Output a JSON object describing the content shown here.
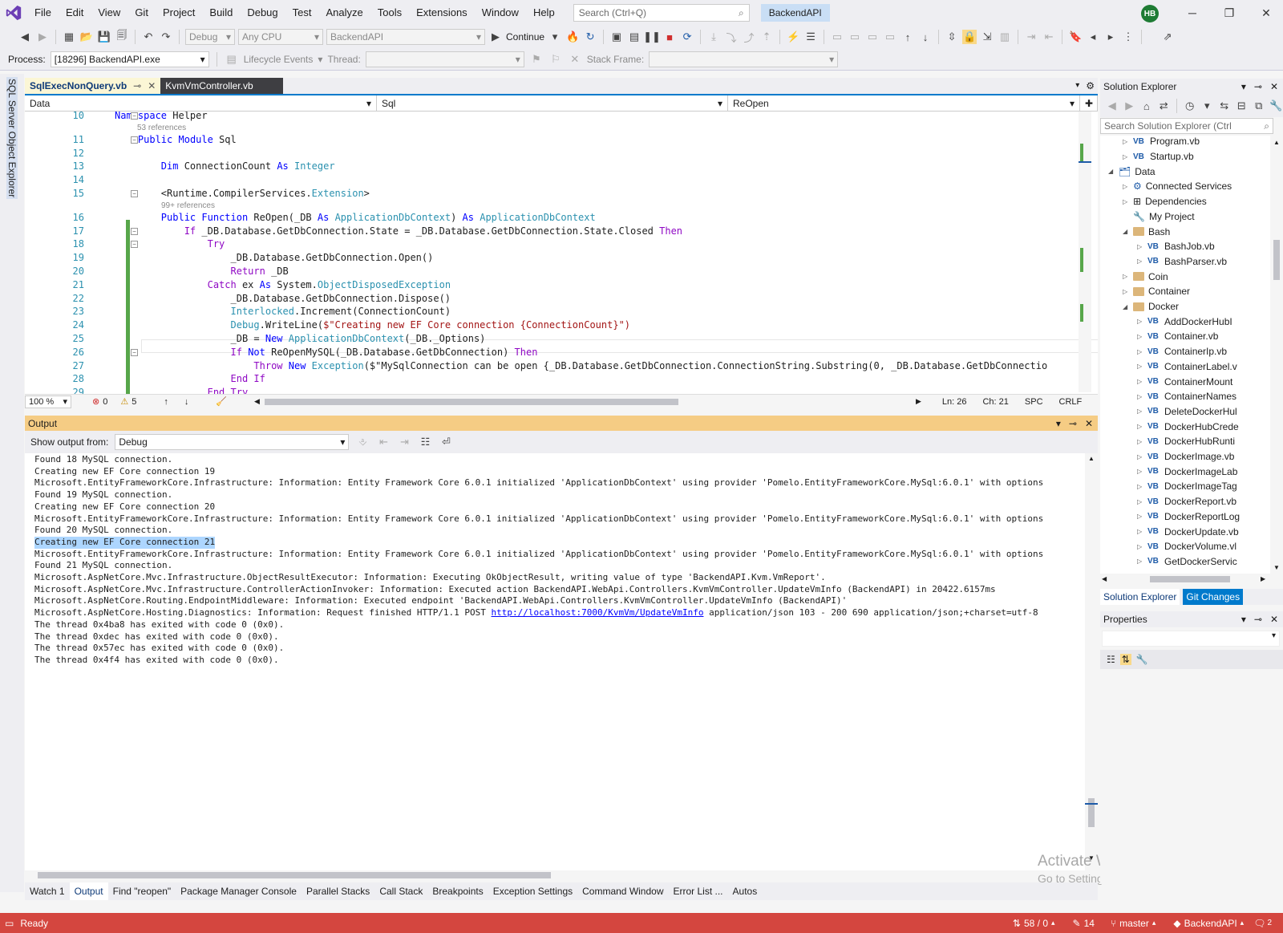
{
  "menu": [
    "File",
    "Edit",
    "View",
    "Git",
    "Project",
    "Build",
    "Debug",
    "Test",
    "Analyze",
    "Tools",
    "Extensions",
    "Window",
    "Help"
  ],
  "search": {
    "placeholder": "Search (Ctrl+Q)"
  },
  "solution_name": "BackendAPI",
  "user_initials": "HB",
  "toolbar": {
    "config": "Debug",
    "platform": "Any CPU",
    "startup": "BackendAPI",
    "continue_label": "Continue"
  },
  "debug_bar": {
    "process_label": "Process:",
    "process_value": "[18296] BackendAPI.exe",
    "lifecycle_label": "Lifecycle Events",
    "thread_label": "Thread:",
    "stackframe_label": "Stack Frame:"
  },
  "left_tab": "SQL Server Object Explorer",
  "doc_tabs": [
    {
      "label": "SqlExecNonQuery.vb",
      "active": true
    },
    {
      "label": "KvmVmController.vb",
      "active": false
    }
  ],
  "navbar": {
    "project": "Data",
    "scope": "Sql",
    "member": "ReOpen"
  },
  "code_lines": [
    {
      "num": "10",
      "text": "Namespace Helper"
    },
    {
      "refs": "53 references"
    },
    {
      "num": "11",
      "text": "    Public Module Sql"
    },
    {
      "num": "12",
      "text": ""
    },
    {
      "num": "13",
      "text": "        Dim ConnectionCount As Integer"
    },
    {
      "num": "14",
      "text": ""
    },
    {
      "num": "15",
      "text": "        <Runtime.CompilerServices.Extension>"
    },
    {
      "refs": "99+ references"
    },
    {
      "num": "16",
      "text": "        Public Function ReOpen(_DB As ApplicationDbContext) As ApplicationDbContext"
    },
    {
      "num": "17",
      "text": "            If _DB.Database.GetDbConnection.State = _DB.Database.GetDbConnection.State.Closed Then"
    },
    {
      "num": "18",
      "text": "                Try"
    },
    {
      "num": "19",
      "text": "                    _DB.Database.GetDbConnection.Open()"
    },
    {
      "num": "20",
      "text": "                    Return _DB"
    },
    {
      "num": "21",
      "text": "                Catch ex As System.ObjectDisposedException"
    },
    {
      "num": "22",
      "text": "                    _DB.Database.GetDbConnection.Dispose()"
    },
    {
      "num": "23",
      "text": "                    Interlocked.Increment(ConnectionCount)"
    },
    {
      "num": "24",
      "text": "                    Debug.WriteLine($\"Creating new EF Core connection {ConnectionCount}\")"
    },
    {
      "num": "25",
      "text": "                    _DB = New ApplicationDbContext(_DB._Options)"
    },
    {
      "num": "26",
      "text": "                    If Not ReOpenMySQL(_DB.Database.GetDbConnection) Then"
    },
    {
      "num": "27",
      "text": "                        Throw New Exception($\"MySqlConnection can be open {_DB.Database.GetDbConnection.ConnectionString.Substring(0, _DB.Database.GetDbConnectio"
    },
    {
      "num": "28",
      "text": "                    End If"
    },
    {
      "num": "29",
      "text": "                End Try"
    }
  ],
  "editor_status": {
    "zoom": "100 %",
    "errors": "0",
    "warnings": "5",
    "line": "Ln: 26",
    "col": "Ch: 21",
    "spacing": "SPC",
    "eol": "CRLF"
  },
  "output": {
    "title": "Output",
    "show_from_label": "Show output from:",
    "show_from_value": "Debug",
    "lines": [
      "Found 18 MySQL connection.",
      "Creating new EF Core connection 19",
      "Microsoft.EntityFrameworkCore.Infrastructure: Information: Entity Framework Core 6.0.1 initialized 'ApplicationDbContext' using provider 'Pomelo.EntityFrameworkCore.MySql:6.0.1' with options",
      "Found 19 MySQL connection.",
      "Creating new EF Core connection 20",
      "Microsoft.EntityFrameworkCore.Infrastructure: Information: Entity Framework Core 6.0.1 initialized 'ApplicationDbContext' using provider 'Pomelo.EntityFrameworkCore.MySql:6.0.1' with options",
      "Found 20 MySQL connection.",
      "Creating new EF Core connection 21",
      "Microsoft.EntityFrameworkCore.Infrastructure: Information: Entity Framework Core 6.0.1 initialized 'ApplicationDbContext' using provider 'Pomelo.EntityFrameworkCore.MySql:6.0.1' with options",
      "Found 21 MySQL connection.",
      "Microsoft.AspNetCore.Mvc.Infrastructure.ObjectResultExecutor: Information: Executing OkObjectResult, writing value of type 'BackendAPI.Kvm.VmReport'.",
      "Microsoft.AspNetCore.Mvc.Infrastructure.ControllerActionInvoker: Information: Executed action BackendAPI.WebApi.Controllers.KvmVmController.UpdateVmInfo (BackendAPI) in 20422.6157ms",
      "Microsoft.AspNetCore.Routing.EndpointMiddleware: Information: Executed endpoint 'BackendAPI.WebApi.Controllers.KvmVmController.UpdateVmInfo (BackendAPI)'",
      "Microsoft.AspNetCore.Hosting.Diagnostics: Information: Request finished HTTP/1.1 POST ",
      "The thread 0x4ba8 has exited with code 0 (0x0).",
      "The thread 0xdec has exited with code 0 (0x0).",
      "The thread 0x57ec has exited with code 0 (0x0).",
      "The thread 0x4f4 has exited with code 0 (0x0)."
    ],
    "selected_index": 7,
    "link_line_index": 13,
    "link_text": "http://localhost:7000/KvmVm/UpdateVmInfo",
    "link_suffix": " application/json 103 - 200 690 application/json;+charset=utf-8"
  },
  "bottom_tabs": [
    "Watch 1",
    "Output",
    "Find \"reopen\"",
    "Package Manager Console",
    "Parallel Stacks",
    "Call Stack",
    "Breakpoints",
    "Exception Settings",
    "Command Window",
    "Error List ...",
    "Autos"
  ],
  "solution_explorer": {
    "title": "Solution Explorer",
    "search_placeholder": "Search Solution Explorer (Ctrl",
    "items": [
      {
        "label": "Program.vb",
        "kind": "vb",
        "level": 1,
        "expander": "closed"
      },
      {
        "label": "Startup.vb",
        "kind": "vb",
        "level": 1,
        "expander": "closed"
      },
      {
        "label": "Data",
        "kind": "project",
        "level": 0,
        "expander": "open"
      },
      {
        "label": "Connected Services",
        "kind": "service",
        "level": 1,
        "expander": "closed"
      },
      {
        "label": "Dependencies",
        "kind": "deps",
        "level": 1,
        "expander": "closed"
      },
      {
        "label": "My Project",
        "kind": "myproj",
        "level": 1,
        "expander": "none"
      },
      {
        "label": "Bash",
        "kind": "folder",
        "level": 1,
        "expander": "open"
      },
      {
        "label": "BashJob.vb",
        "kind": "vb",
        "level": 2,
        "expander": "closed"
      },
      {
        "label": "BashParser.vb",
        "kind": "vb",
        "level": 2,
        "expander": "closed"
      },
      {
        "label": "Coin",
        "kind": "folder",
        "level": 1,
        "expander": "closed"
      },
      {
        "label": "Container",
        "kind": "folder",
        "level": 1,
        "expander": "closed"
      },
      {
        "label": "Docker",
        "kind": "folder",
        "level": 1,
        "expander": "open"
      },
      {
        "label": "AddDockerHubI",
        "kind": "vb",
        "level": 2,
        "expander": "closed"
      },
      {
        "label": "Container.vb",
        "kind": "vb",
        "level": 2,
        "expander": "closed"
      },
      {
        "label": "ContainerIp.vb",
        "kind": "vb",
        "level": 2,
        "expander": "closed"
      },
      {
        "label": "ContainerLabel.v",
        "kind": "vb",
        "level": 2,
        "expander": "closed"
      },
      {
        "label": "ContainerMount",
        "kind": "vb",
        "level": 2,
        "expander": "closed"
      },
      {
        "label": "ContainerNames",
        "kind": "vb",
        "level": 2,
        "expander": "closed"
      },
      {
        "label": "DeleteDockerHul",
        "kind": "vb",
        "level": 2,
        "expander": "closed"
      },
      {
        "label": "DockerHubCrede",
        "kind": "vb",
        "level": 2,
        "expander": "closed"
      },
      {
        "label": "DockerHubRunti",
        "kind": "vb",
        "level": 2,
        "expander": "closed"
      },
      {
        "label": "DockerImage.vb",
        "kind": "vb",
        "level": 2,
        "expander": "closed"
      },
      {
        "label": "DockerImageLab",
        "kind": "vb",
        "level": 2,
        "expander": "closed"
      },
      {
        "label": "DockerImageTag",
        "kind": "vb",
        "level": 2,
        "expander": "closed"
      },
      {
        "label": "DockerReport.vb",
        "kind": "vb",
        "level": 2,
        "expander": "closed"
      },
      {
        "label": "DockerReportLog",
        "kind": "vb",
        "level": 2,
        "expander": "closed"
      },
      {
        "label": "DockerUpdate.vb",
        "kind": "vb",
        "level": 2,
        "expander": "closed"
      },
      {
        "label": "DockerVolume.vl",
        "kind": "vb",
        "level": 2,
        "expander": "closed"
      },
      {
        "label": "GetDockerServic",
        "kind": "vb",
        "level": 2,
        "expander": "closed"
      }
    ],
    "tabs": [
      "Solution Explorer",
      "Git Changes"
    ]
  },
  "properties": {
    "title": "Properties"
  },
  "watermark": {
    "line1": "Activate Windows",
    "line2": "Go to Settings to activate Windows."
  },
  "statusbar": {
    "ready": "Ready",
    "commits": "58 / 0",
    "changes": "14",
    "branch": "master",
    "repo": "BackendAPI",
    "notifications": "2"
  },
  "colors": {
    "accent": "#007acc",
    "statusbar": "#d4463f",
    "output_header": "#f5cc84"
  }
}
